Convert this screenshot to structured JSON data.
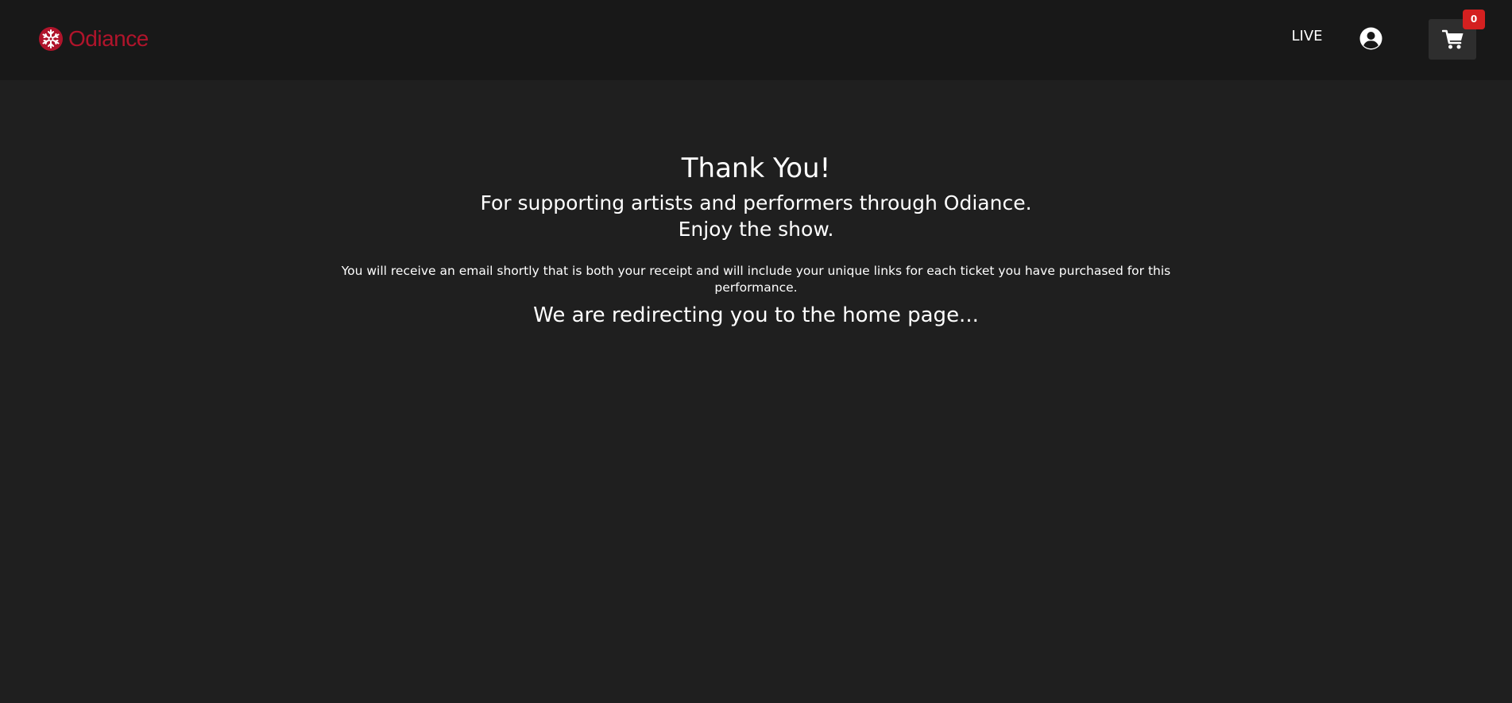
{
  "header": {
    "brand": "Odiance",
    "brand_color": "#b0142b",
    "logo_icon": "snowflake-logo-icon",
    "nav_live": "LIVE",
    "user_icon": "user-circle-icon",
    "cart_icon": "shopping-cart-icon",
    "cart_count": "0",
    "badge_color": "#d42020"
  },
  "main": {
    "title": "Thank You!",
    "subtitle_line1": "For supporting artists and performers through Odiance.",
    "subtitle_line2": "Enjoy the show.",
    "notice": "You will receive an email shortly that is both your receipt and will include your unique links for each ticket you have purchased for this performance.",
    "redirect": "We are redirecting you to the home page..."
  }
}
